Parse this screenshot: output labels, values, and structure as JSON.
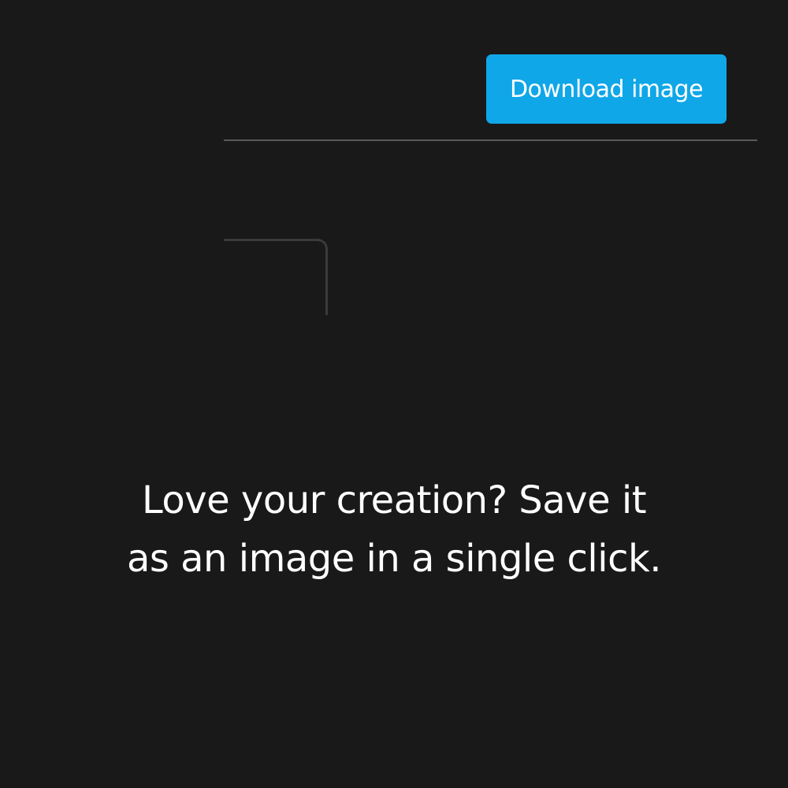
{
  "toolbar": {
    "download_label": "Download image"
  },
  "caption": {
    "line1": "Love your creation? Save it",
    "line2": "as an image in a single click."
  },
  "colors": {
    "background": "#191919",
    "accent": "#10a7e8",
    "divider": "#5a5a5a",
    "frame": "#3a3a3a",
    "text": "#ffffff"
  }
}
